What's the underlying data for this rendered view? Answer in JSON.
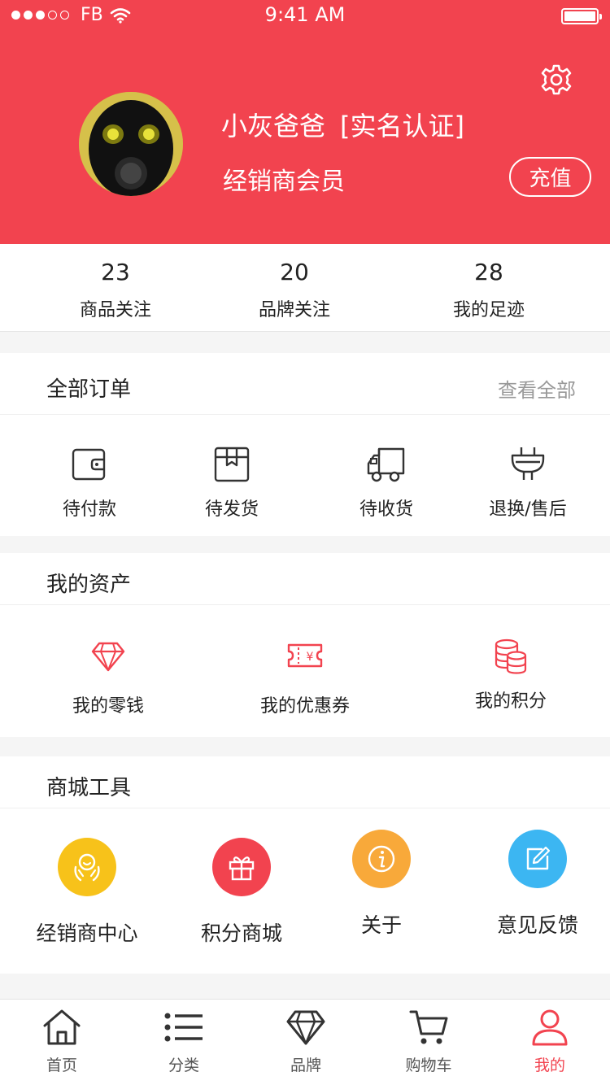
{
  "status_bar": {
    "carrier": "FB",
    "time": "9:41 AM"
  },
  "profile": {
    "name": "小灰爸爸",
    "verify_tag": "[实名认证]",
    "member_level": "经销商会员",
    "recharge_label": "充值",
    "avatar_icon": "gas-mask-avatar"
  },
  "stats": [
    {
      "value": "23",
      "label": "商品关注"
    },
    {
      "value": "20",
      "label": "品牌关注"
    },
    {
      "value": "28",
      "label": "我的足迹"
    }
  ],
  "orders": {
    "title": "全部订单",
    "view_all": "查看全部",
    "items": [
      {
        "label": "待付款",
        "icon": "wallet-icon"
      },
      {
        "label": "待发货",
        "icon": "box-icon"
      },
      {
        "label": "待收货",
        "icon": "truck-icon"
      },
      {
        "label": "退换/售后",
        "icon": "plug-icon"
      }
    ]
  },
  "assets": {
    "title": "我的资产",
    "items": [
      {
        "label": "我的零钱",
        "icon": "diamond-icon"
      },
      {
        "label": "我的优惠券",
        "icon": "coupon-icon"
      },
      {
        "label": "我的积分",
        "icon": "coins-icon"
      }
    ]
  },
  "tools": {
    "title": "商城工具",
    "items": [
      {
        "label": "经销商中心",
        "icon": "hands-icon",
        "color": "#f7c21a"
      },
      {
        "label": "积分商城",
        "icon": "gift-icon",
        "color": "#f2434f"
      },
      {
        "label": "关于",
        "icon": "info-icon",
        "color": "#f8a93a"
      },
      {
        "label": "意见反馈",
        "icon": "edit-icon",
        "color": "#3cb6f2"
      }
    ]
  },
  "tabbar": [
    {
      "label": "首页",
      "icon": "home-icon",
      "active": false
    },
    {
      "label": "分类",
      "icon": "list-icon",
      "active": false
    },
    {
      "label": "品牌",
      "icon": "diamond-icon",
      "active": false
    },
    {
      "label": "购物车",
      "icon": "cart-icon",
      "active": false
    },
    {
      "label": "我的",
      "icon": "user-icon",
      "active": true
    }
  ],
  "colors": {
    "primary": "#f2434f",
    "background": "#f5f5f5"
  }
}
